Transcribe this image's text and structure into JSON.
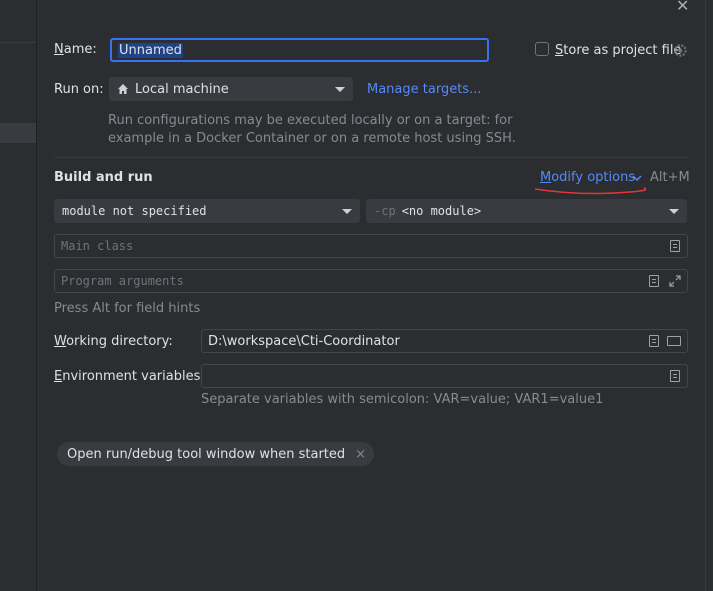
{
  "close_symbol": "✕",
  "name_label": "Name:",
  "name_value": "Unnamed",
  "store_label": "Store as project file",
  "run_on_label": "Run on:",
  "run_on_value": "Local machine",
  "manage_targets": "Manage targets...",
  "run_on_hint_1": "Run configurations may be executed locally or on a target: for",
  "run_on_hint_2": "example in a Docker Container or on a remote host using SSH.",
  "build_run_title": "Build and run",
  "modify_options": "Modify options",
  "modify_shortcut": "Alt+M",
  "module_value": "module not specified",
  "cp_prefix": "-cp",
  "cp_value": "<no module>",
  "main_class_placeholder": "Main class",
  "program_args_placeholder": "Program arguments",
  "field_hint": "Press Alt for field hints",
  "working_dir_label": "Working directory:",
  "working_dir_value": "D:\\workspace\\Cti-Coordinator",
  "env_label": "Environment variables:",
  "env_hint": "Separate variables with semicolon: VAR=value; VAR1=value1",
  "chip_label": "Open run/debug tool window when started",
  "chip_close": "×",
  "colors": {
    "accent": "#3574f0",
    "link": "#548af7",
    "underline": "#e0373f"
  }
}
